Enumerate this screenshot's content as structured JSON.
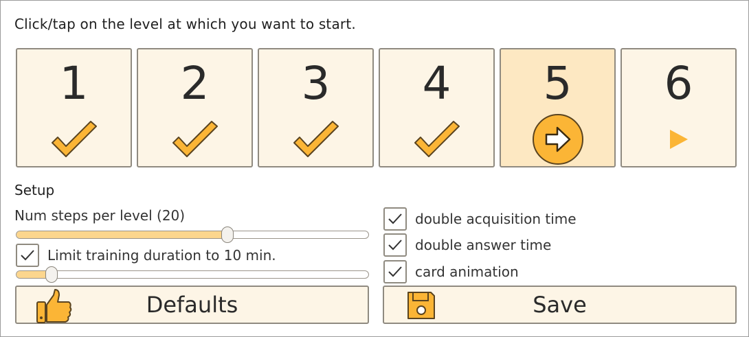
{
  "instruction": "Click/tap on the level at which you want to start.",
  "levels": [
    {
      "number": "1",
      "status": "completed",
      "icon": "checkmark-icon"
    },
    {
      "number": "2",
      "status": "completed",
      "icon": "checkmark-icon"
    },
    {
      "number": "3",
      "status": "completed",
      "icon": "checkmark-icon"
    },
    {
      "number": "4",
      "status": "completed",
      "icon": "checkmark-icon"
    },
    {
      "number": "5",
      "status": "current",
      "icon": "arrow-right-circle-icon"
    },
    {
      "number": "6",
      "status": "next",
      "icon": "play-triangle-icon"
    }
  ],
  "setup": {
    "title": "Setup",
    "steps_label": "Num steps per level (20)",
    "steps_slider_fraction": 0.6,
    "limit_training": {
      "label": "Limit training duration to 10 min.",
      "checked": true
    },
    "duration_slider_fraction": 0.1,
    "options": [
      {
        "label": "double acquisition time",
        "checked": true
      },
      {
        "label": "double answer time",
        "checked": true
      },
      {
        "label": "card animation",
        "checked": true
      }
    ]
  },
  "buttons": {
    "defaults_label": "Defaults",
    "defaults_icon": "thumbs-up-icon",
    "save_label": "Save",
    "save_icon": "floppy-disk-icon"
  },
  "colors": {
    "accent": "#fbb536",
    "accent_outline": "#5a4420",
    "tile_bg": "#fdf5e6",
    "tile_current_bg": "#fde8c2",
    "slider_fill": "#fcd68e"
  }
}
